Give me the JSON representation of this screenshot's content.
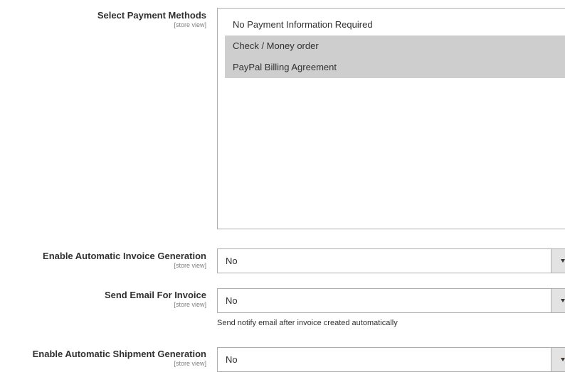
{
  "payment_methods": {
    "label": "Select Payment Methods",
    "scope": "[store view]",
    "options": [
      {
        "label": "No Payment Information Required",
        "selected": false
      },
      {
        "label": "Check / Money order",
        "selected": true
      },
      {
        "label": "PayPal Billing Agreement",
        "selected": true
      }
    ]
  },
  "invoice_generation": {
    "label": "Enable Automatic Invoice Generation",
    "scope": "[store view]",
    "value": "No"
  },
  "invoice_email": {
    "label": "Send Email For Invoice",
    "scope": "[store view]",
    "value": "No",
    "note": "Send notify email after invoice created automatically"
  },
  "shipment_generation": {
    "label": "Enable Automatic Shipment Generation",
    "scope": "[store view]",
    "value": "No"
  },
  "colors": {
    "selected_option_bg": "#cecece",
    "border": "#adadad",
    "arrow_bg": "#e3e3e3"
  }
}
